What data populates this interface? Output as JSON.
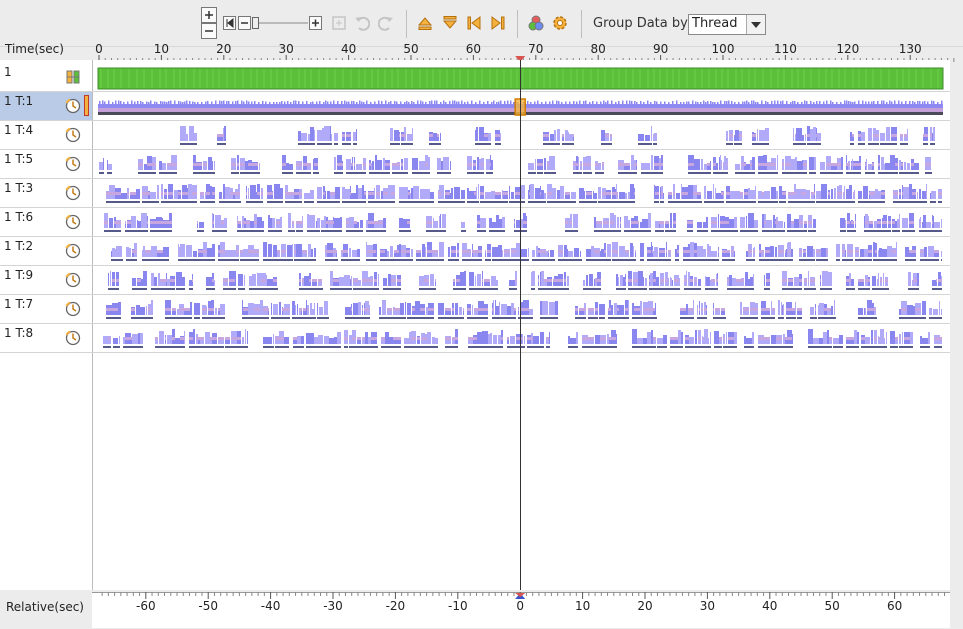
{
  "toolbar": {
    "buttons": [
      {
        "name": "zoom-in-button"
      },
      {
        "name": "zoom-out-button"
      },
      {
        "name": "zoom-reset-button"
      },
      {
        "name": "zoom-minus-button"
      },
      {
        "name": "zoom-plus-button"
      },
      {
        "name": "undo-button"
      },
      {
        "name": "redo-button"
      }
    ],
    "group_label": "Group Data by:",
    "group_value": "Thread"
  },
  "time_axis": {
    "label": "Time(sec)",
    "ticks": [
      "0",
      "10",
      "20",
      "30",
      "40",
      "50",
      "60",
      "70",
      "80",
      "90",
      "100",
      "110",
      "120",
      "130"
    ],
    "cursor_value": 67.5
  },
  "relative_axis": {
    "label": "Relative(sec)",
    "ticks": [
      "-60",
      "-50",
      "-40",
      "-30",
      "-20",
      "-10",
      "0",
      "10",
      "20",
      "30",
      "40",
      "50",
      "60"
    ]
  },
  "rows": [
    {
      "label": "1",
      "icon": "bars-icon",
      "kind": "process"
    },
    {
      "label": "1 T:1",
      "icon": "clock-icon",
      "kind": "main-thread",
      "selected": true
    },
    {
      "label": "1 T:4",
      "icon": "clock-icon",
      "kind": "thread",
      "density": 0.35
    },
    {
      "label": "1 T:5",
      "icon": "clock-icon",
      "kind": "thread",
      "density": 0.55
    },
    {
      "label": "1 T:3",
      "icon": "clock-icon",
      "kind": "thread",
      "density": 0.9
    },
    {
      "label": "1 T:6",
      "icon": "clock-icon",
      "kind": "thread",
      "density": 0.65
    },
    {
      "label": "1 T:2",
      "icon": "clock-icon",
      "kind": "thread",
      "density": 0.85
    },
    {
      "label": "1 T:9",
      "icon": "clock-icon",
      "kind": "thread",
      "density": 0.7
    },
    {
      "label": "1 T:7",
      "icon": "clock-icon",
      "kind": "thread",
      "density": 0.6
    },
    {
      "label": "1 T:8",
      "icon": "clock-icon",
      "kind": "thread",
      "density": 0.8
    }
  ],
  "colors": {
    "process_bar": "#5bbf3a",
    "event_bar": "#8a86f0",
    "event_bar_light": "#b0aaf8",
    "main_thread_band": "#c49fd8",
    "selection": "#b9cbe6",
    "cursor": "#333333",
    "cursor_marker": "#d9534f"
  }
}
